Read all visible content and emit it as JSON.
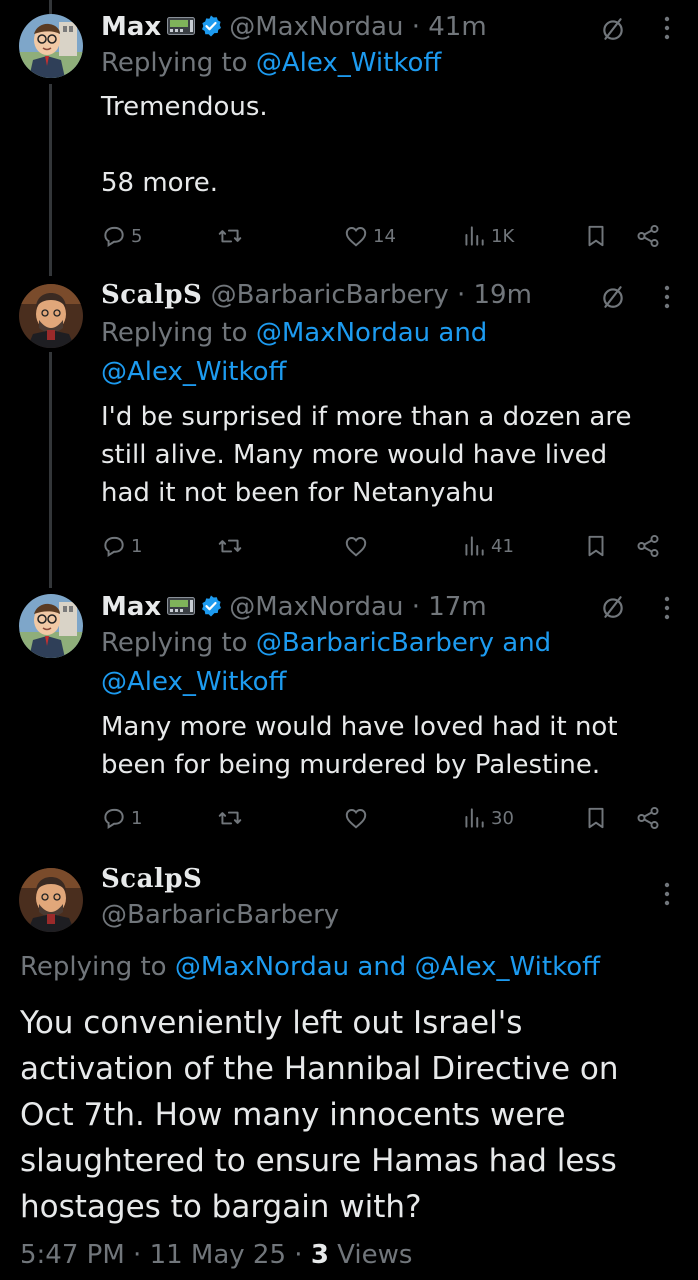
{
  "tweets": [
    {
      "name": "Max",
      "handle": "@MaxNordau",
      "time": "· 41m",
      "replying_prefix": "Replying to ",
      "replying_mentions": "@Alex_Witkoff",
      "replying_join": "",
      "replying_mentions2": "",
      "text": "Tremendous.\n\n58 more.",
      "replies": "5",
      "reposts": "",
      "likes": "14",
      "views": "1K"
    },
    {
      "name": "ScalpS",
      "handle": "@BarbaricBarbery",
      "time": "· 19m",
      "replying_prefix": "Replying to ",
      "replying_mentions": "@MaxNordau and",
      "replying_line2": "@Alex_Witkoff",
      "text": "I'd be surprised if more than a dozen are still alive. Many more would have lived had it not been for Netanyahu",
      "replies": "1",
      "reposts": "",
      "likes": "",
      "views": "41"
    },
    {
      "name": "Max",
      "handle": "@MaxNordau",
      "time": "· 17m",
      "replying_prefix": "Replying to ",
      "replying_mentions": "@BarbaricBarbery and",
      "replying_line2": "@Alex_Witkoff",
      "text": "Many more would have loved had it not been for being murdered by Palestine.",
      "replies": "1",
      "reposts": "",
      "likes": "",
      "views": "30"
    }
  ],
  "main": {
    "name": "ScalpS",
    "handle": "@BarbaricBarbery",
    "replying_prefix": "Replying to ",
    "replying_mention1": "@MaxNordau",
    "replying_and": " and ",
    "replying_mention2": "@Alex_Witkoff",
    "text": "You conveniently left out Israel's activation of the Hannibal Directive on Oct 7th.  How many innocents were slaughtered to ensure Hamas had less hostages to bargain with?",
    "time": "5:47 PM",
    "date": "11 May 25",
    "views_count": "3",
    "views_label": "Views"
  },
  "icons": {
    "reply": "reply-icon",
    "repost": "repost-icon",
    "like": "heart-icon",
    "views": "views-icon",
    "bookmark": "bookmark-icon",
    "share": "share-icon",
    "mute": "mute-icon",
    "more": "more-icon",
    "verified": "verified-badge-icon",
    "pager": "pager-icon"
  },
  "colors": {
    "background": "#000000",
    "text": "#e7e9ea",
    "muted": "#71767b",
    "accent": "#1d9bf0"
  }
}
